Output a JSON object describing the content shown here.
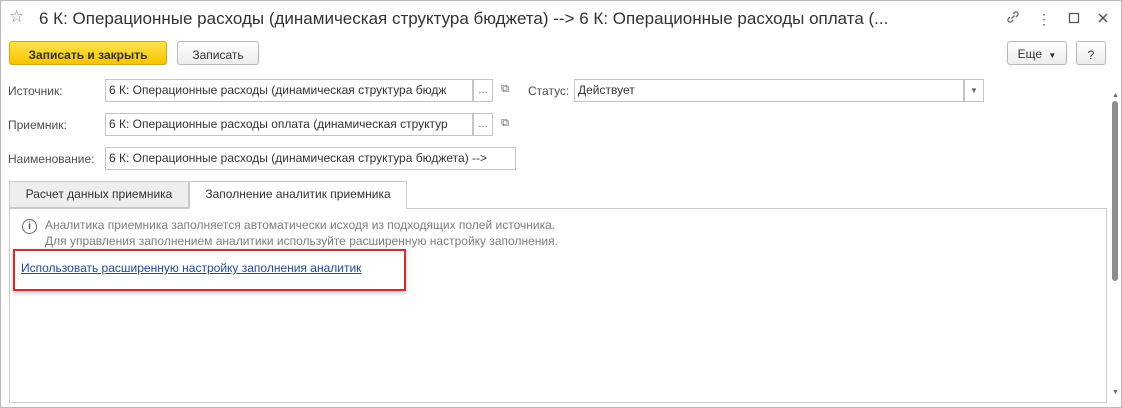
{
  "window": {
    "title": "6 К: Операционные расходы (динамическая структура бюджета) --> 6 К: Операционные расходы оплата  (...",
    "link_icon": "link-icon",
    "more_icon": "more-vertical-icon",
    "minimize_icon": "minimize-icon",
    "close_icon": "close-icon"
  },
  "toolbar": {
    "save_close_label": "Записать и закрыть",
    "save_label": "Записать",
    "more_label": "Еще",
    "help_label": "?"
  },
  "form": {
    "source_label": "Источник:",
    "source_value": "6 К: Операционные расходы (динамическая структура бюдж",
    "receiver_label": "Приемник:",
    "receiver_value": "6 К: Операционные расходы оплата  (динамическая структур",
    "name_label": "Наименование:",
    "name_value": "6 К: Операционные расходы (динамическая структура бюджета) -->",
    "status_label": "Статус:",
    "status_value": "Действует",
    "select_button": "...",
    "open_button": "⧉"
  },
  "tabs": [
    {
      "label": "Расчет данных приемника"
    },
    {
      "label": "Заполнение аналитик приемника"
    }
  ],
  "panel": {
    "info_line1": "Аналитика приемника заполняется автоматически исходя из подходящих полей источника.",
    "info_line2": "Для управления заполнением аналитики используйте расширенную настройку заполнения.",
    "link_text": "Использовать расширенную настройку заполнения аналитик"
  },
  "colors": {
    "accent": "#f6c400",
    "link": "#1f4a99",
    "highlight": "#d62b2b"
  }
}
